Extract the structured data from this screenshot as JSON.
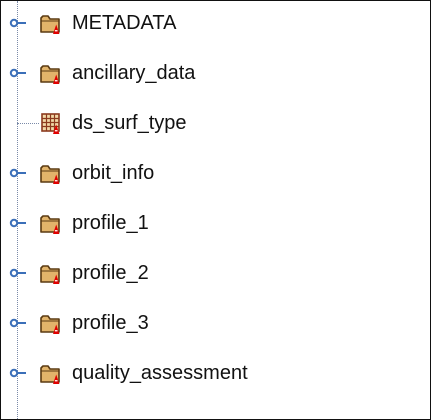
{
  "tree": {
    "items": [
      {
        "label": "METADATA",
        "type": "group",
        "icon": "folder-group-icon",
        "expandable": true
      },
      {
        "label": "ancillary_data",
        "type": "group",
        "icon": "folder-group-icon",
        "expandable": true
      },
      {
        "label": "ds_surf_type",
        "type": "dataset",
        "icon": "dataset-grid-icon",
        "expandable": false
      },
      {
        "label": "orbit_info",
        "type": "group",
        "icon": "folder-group-icon",
        "expandable": true
      },
      {
        "label": "profile_1",
        "type": "group",
        "icon": "folder-group-icon",
        "expandable": true
      },
      {
        "label": "profile_2",
        "type": "group",
        "icon": "folder-group-icon",
        "expandable": true
      },
      {
        "label": "profile_3",
        "type": "group",
        "icon": "folder-group-icon",
        "expandable": true
      },
      {
        "label": "quality_assessment",
        "type": "group",
        "icon": "folder-group-icon",
        "expandable": true
      }
    ]
  },
  "colors": {
    "folder_fill": "#E2B46A",
    "folder_outline": "#5A3A12",
    "badge_red": "#E00000",
    "handle_blue": "#3B6FB8",
    "grid_line": "#8B3A1E"
  }
}
